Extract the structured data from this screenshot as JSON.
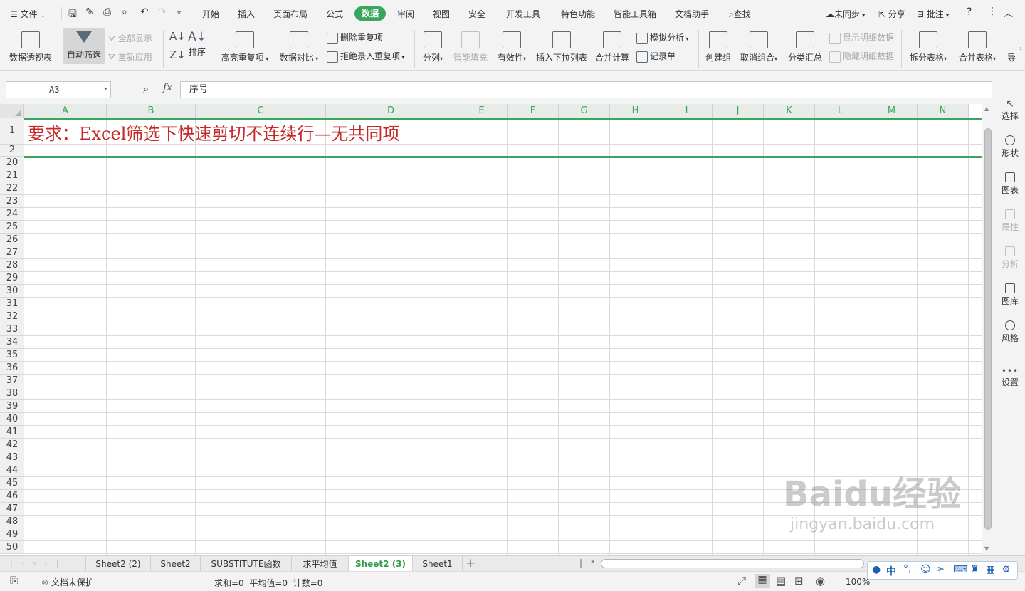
{
  "menubar": {
    "file": "文件",
    "tabs": [
      "开始",
      "插入",
      "页面布局",
      "公式",
      "数据",
      "审阅",
      "视图",
      "安全",
      "开发工具",
      "特色功能",
      "智能工具箱",
      "文档助手"
    ],
    "active_tab": "数据",
    "search": "查找",
    "sync": "未同步",
    "share": "分享",
    "comment": "批注"
  },
  "ribbon": {
    "pivot": "数据透视表",
    "autofilter": "自动筛选",
    "show_all": "全部显示",
    "reapply": "重新应用",
    "sort": "排序",
    "highlight_dup": "高亮重复项",
    "compare": "数据对比",
    "delete_dup": "删除重复项",
    "reject_dup": "拒绝录入重复项",
    "split": "分列",
    "smart_fill": "智能填充",
    "validity": "有效性",
    "insert_dropdown": "插入下拉列表",
    "consolidate": "合并计算",
    "simulate": "模拟分析",
    "record": "记录单",
    "create_group": "创建组",
    "ungroup": "取消组合",
    "subtotal": "分类汇总",
    "show_detail": "显示明细数据",
    "hide_detail": "隐藏明细数据",
    "split_table": "拆分表格",
    "merge_table": "合并表格",
    "more": "导"
  },
  "formula": {
    "namebox": "A3",
    "fx": "fx",
    "content": "序号"
  },
  "grid": {
    "columns": [
      "A",
      "B",
      "C",
      "D",
      "E",
      "F",
      "G",
      "H",
      "I",
      "J",
      "K",
      "L",
      "M",
      "N"
    ],
    "rows": [
      "1",
      "2",
      "20",
      "21",
      "22",
      "23",
      "24",
      "25",
      "26",
      "27",
      "28",
      "29",
      "30",
      "31",
      "32",
      "33",
      "34",
      "35",
      "36",
      "37",
      "38",
      "39",
      "40",
      "41",
      "42",
      "43",
      "44",
      "45",
      "46",
      "47",
      "48",
      "49",
      "50"
    ],
    "title": "要求：Excel筛选下快速剪切不连续行—无共同项"
  },
  "rightpanel": {
    "items": [
      "选择",
      "形状",
      "图表",
      "属性",
      "分析",
      "图库",
      "风格",
      "设置"
    ]
  },
  "sheets": {
    "tabs": [
      "Sheet2 (2)",
      "Sheet2",
      "SUBSTITUTE函数",
      "求平均值",
      "Sheet2 (3)",
      "Sheet1"
    ],
    "active": "Sheet2 (3)",
    "add": "+"
  },
  "status": {
    "protect": "文档未保护",
    "summary": "求和=0  平均值=0  计数=0",
    "zoom": "100%"
  },
  "watermark": {
    "brand": "Baidu经验",
    "url": "jingyan.baidu.com"
  },
  "ime": {
    "mode": "中"
  },
  "colors": {
    "accent": "#3aa55c",
    "title_red": "#c62828"
  }
}
